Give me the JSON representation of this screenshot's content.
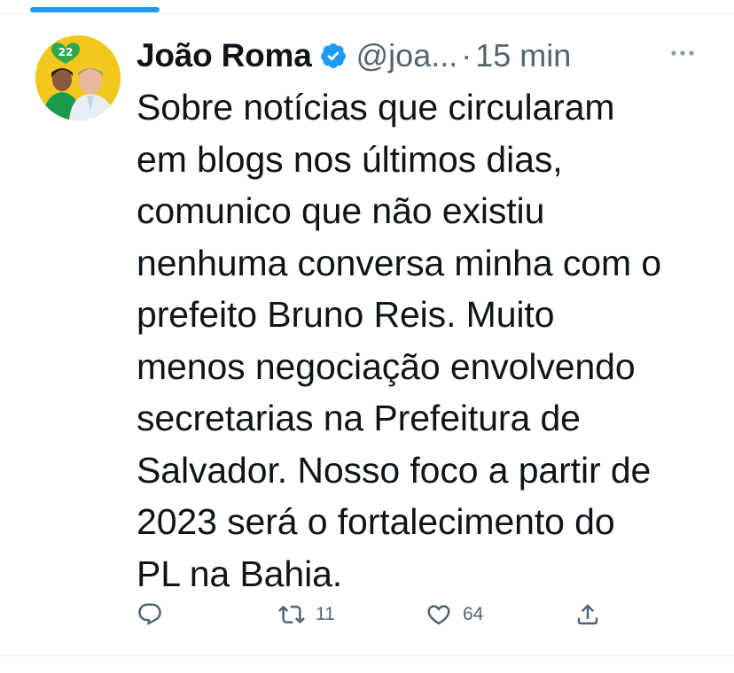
{
  "colors": {
    "accent": "#1d9bf0",
    "text_primary": "#0f1419",
    "text_secondary": "#536471",
    "avatar_bg": "#f2c81e",
    "divider": "#eff3f4"
  },
  "tweet": {
    "author_name": "João Roma",
    "verified": true,
    "handle": "@joa...",
    "separator": "·",
    "time": "15 min",
    "avatar_badge": "22",
    "text": "Sobre notícias que circularam\nem blogs nos últimos dias,\ncomunico que não existiu\nnenhuma conversa minha com o\nprefeito Bruno Reis. Muito\nmenos negociação envolvendo\nsecretarias na Prefeitura de\nSalvador. Nosso foco a partir de\n2023 será o fortalecimento do\nPL na Bahia.",
    "actions": {
      "reply": {
        "icon": "reply-icon",
        "count": ""
      },
      "retweet": {
        "icon": "retweet-icon",
        "count": "11"
      },
      "like": {
        "icon": "heart-icon",
        "count": "64"
      },
      "share": {
        "icon": "share-icon",
        "count": ""
      }
    }
  }
}
